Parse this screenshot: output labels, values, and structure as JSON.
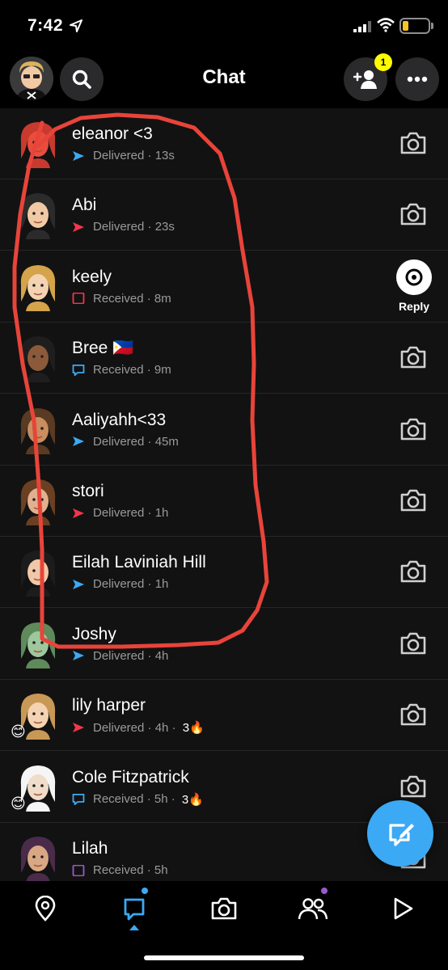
{
  "status_bar": {
    "time": "7:42"
  },
  "header": {
    "title": "Chat",
    "friend_request_count": "1"
  },
  "colors": {
    "sent_blue": "#3ca9f4",
    "sent_red": "#f2374c",
    "received_purple": "#9b59d0",
    "accent_yellow": "#fffc00",
    "annotation_red": "#e8443a"
  },
  "chats": [
    {
      "name": "eleanor <3",
      "status": "Delivered",
      "time": "13s",
      "icon": "sent-arrow-blue",
      "streak": ""
    },
    {
      "name": "Abi",
      "status": "Delivered",
      "time": "23s",
      "icon": "sent-arrow-red",
      "streak": ""
    },
    {
      "name": "keely",
      "status": "Received",
      "time": "8m",
      "icon": "received-square-red",
      "streak": "",
      "reply_label": "Reply"
    },
    {
      "name": "Bree 🇵🇭",
      "status": "Received",
      "time": "9m",
      "icon": "received-chat-blue",
      "streak": ""
    },
    {
      "name": "Aaliyahh<33",
      "status": "Delivered",
      "time": "45m",
      "icon": "sent-arrow-blue",
      "streak": ""
    },
    {
      "name": "stori",
      "status": "Delivered",
      "time": "1h",
      "icon": "sent-arrow-red",
      "streak": ""
    },
    {
      "name": "Eilah Laviniah Hill",
      "status": "Delivered",
      "time": "1h",
      "icon": "sent-arrow-blue",
      "streak": ""
    },
    {
      "name": "Joshy",
      "status": "Delivered",
      "time": "4h",
      "icon": "sent-arrow-blue",
      "streak": ""
    },
    {
      "name": "lily harper",
      "status": "Delivered",
      "time": "4h",
      "icon": "sent-arrow-red",
      "streak": "3🔥",
      "sticker": "😊"
    },
    {
      "name": "Cole Fitzpatrick",
      "status": "Received",
      "time": "5h",
      "icon": "received-chat-blue",
      "streak": "3🔥",
      "sticker": "😊"
    },
    {
      "name": "Lilah",
      "status": "Received",
      "time": "5h",
      "icon": "received-square-purple",
      "streak": ""
    }
  ],
  "bottom_nav": [
    "map-icon",
    "chat-icon",
    "camera-icon",
    "friends-icon",
    "spotlight-icon"
  ]
}
